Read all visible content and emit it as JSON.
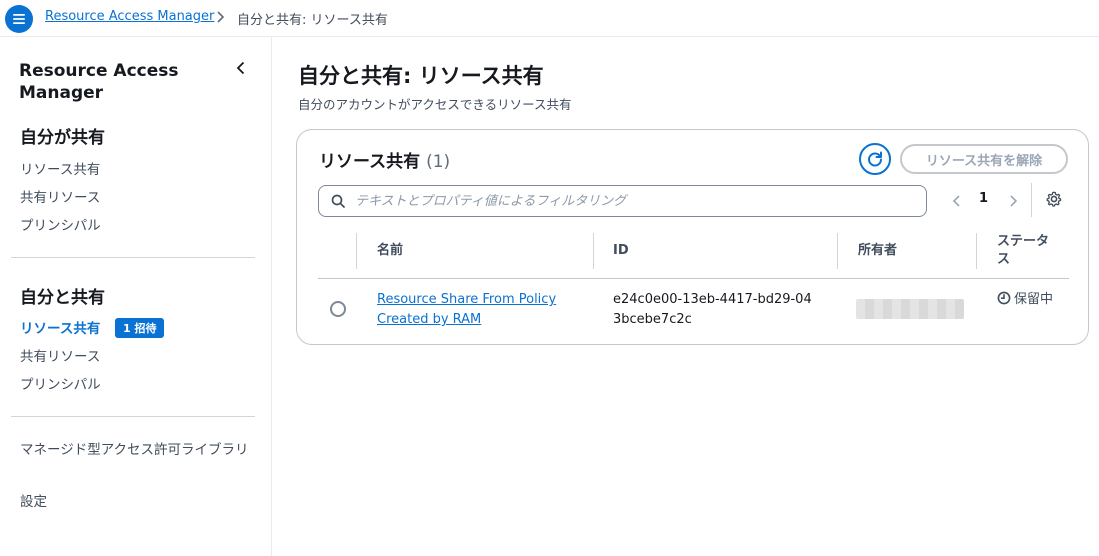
{
  "breadcrumb": {
    "root": "Resource Access Manager",
    "current": "自分と共有: リソース共有"
  },
  "sidebar": {
    "title": "Resource Access Manager",
    "section1": {
      "heading": "自分が共有",
      "items": [
        "リソース共有",
        "共有リソース",
        "プリンシパル"
      ]
    },
    "section2": {
      "heading": "自分と共有",
      "items": [
        "リソース共有",
        "共有リソース",
        "プリンシパル"
      ],
      "badge": "1 招待"
    },
    "section3": {
      "items": [
        "マネージド型アクセス許可ライブラリ",
        "設定"
      ]
    }
  },
  "page": {
    "title": "自分と共有: リソース共有",
    "description": "自分のアカウントがアクセスできるリソース共有"
  },
  "card": {
    "title": "リソース共有",
    "count": "(1)",
    "unshare_label": "リソース共有を解除",
    "search_placeholder": "テキストとプロパティ値によるフィルタリング",
    "page_number": "1"
  },
  "table": {
    "headers": [
      "名前",
      "ID",
      "所有者",
      "ステータス"
    ],
    "rows": [
      {
        "name": "Resource Share From Policy Created by RAM",
        "id": "e24c0e00-13eb-4417-bd29-043bcebe7c2c",
        "status": "保留中"
      }
    ]
  },
  "colors": {
    "accent": "#0972d3",
    "text": "#16191f",
    "muted": "#414d5c",
    "border": "#c6c6cd"
  },
  "icons": {
    "menu": "hamburger-menu-icon",
    "collapse": "chevron-left-icon",
    "refresh": "refresh-icon",
    "search": "search-icon",
    "settings": "gear-icon",
    "pending": "clock-icon"
  }
}
